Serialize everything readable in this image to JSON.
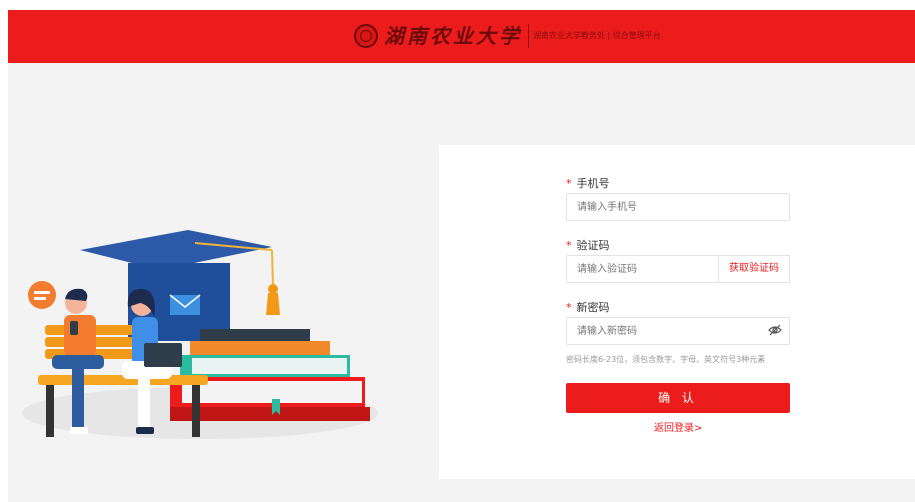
{
  "header": {
    "logo_name": "湖南农业大学",
    "logo_subtitle": "湖南农业大学教务处 | 综合管理平台"
  },
  "form": {
    "phone": {
      "label": "手机号",
      "placeholder": "请输入手机号"
    },
    "code": {
      "label": "验证码",
      "placeholder": "请输入验证码",
      "button": "获取验证码"
    },
    "password": {
      "label": "新密码",
      "placeholder": "请输入新密码",
      "toggle_icon": "eye-off-icon"
    },
    "password_hint": "密码长度6-23位，须包含数字、字母、英文符号3种元素",
    "confirm_label": "确 认",
    "back_label": "返回登录>"
  },
  "colors": {
    "brand": "#ec1c1c",
    "background": "#f3f3f3"
  }
}
